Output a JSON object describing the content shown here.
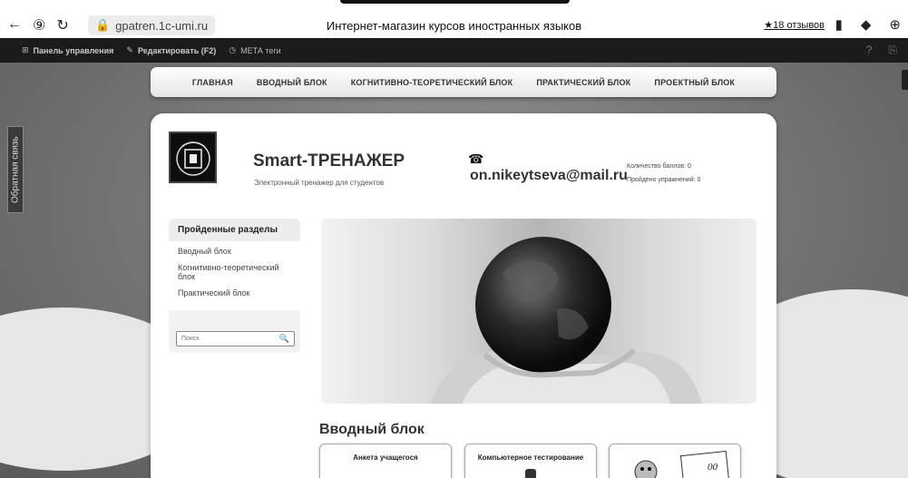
{
  "browser": {
    "url": "gpatren.1c-umi.ru",
    "title": "Интернет-магазин курсов иностранных языков",
    "reviews": "★18 отзывов"
  },
  "admin_bar": {
    "control_panel": "Панель управления",
    "edit": "Редактировать (F2)",
    "meta": "МЕТА теги"
  },
  "feedback": "Обратная связь",
  "nav": {
    "items": [
      "ГЛАВНАЯ",
      "ВВОДНЫЙ БЛОК",
      "КОГНИТИВНО-ТЕОРЕТИЧЕСКИЙ БЛОК",
      "ПРАКТИЧЕСКИЙ БЛОК",
      "ПРОЕКТНЫЙ БЛОК"
    ]
  },
  "header": {
    "brand": "Smart-ТРЕНАЖЕР",
    "tagline": "Электронный тренажер для студентов",
    "email": "on.nikeytseva@mail.ru",
    "score": "Количество баллов: 0",
    "done": "Пройдено упражнений: 0"
  },
  "sidebar": {
    "title": "Пройденные разделы",
    "items": [
      "Вводный блок",
      "Когнитивно-теоретический блок",
      "Практический блок"
    ],
    "search_placeholder": "Поиск"
  },
  "content": {
    "section_title": "Вводный блок",
    "cards": [
      "Анкета учащегося",
      "Компьютерное тестирование",
      ""
    ]
  },
  "icons": {
    "back": "back-arrow-icon",
    "yandex": "yandex-icon",
    "reload": "reload-icon",
    "lock": "lock-icon",
    "phone": "phone-icon",
    "search": "search-icon"
  }
}
